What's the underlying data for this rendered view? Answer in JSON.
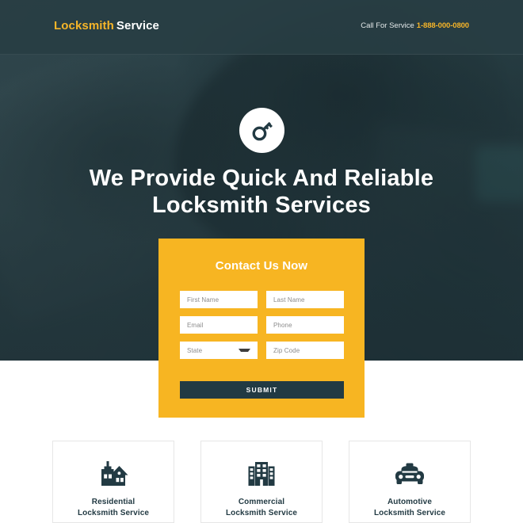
{
  "header": {
    "logo_primary": "Locksmith",
    "logo_secondary": "Service",
    "call_label": "Call For Service",
    "phone": "1-888-000-0800",
    "accent_color": "#f6b529",
    "bar_color": "#283d43"
  },
  "hero": {
    "badge_icon": "key-icon",
    "headline_line1": "We Provide Quick And Reliable",
    "headline_line2": "Locksmith Services",
    "background_image": "blurred-door-lock-photo",
    "overlay_color": "#24383e"
  },
  "form": {
    "title": "Contact Us Now",
    "background_color": "#f7b522",
    "fields": [
      {
        "name": "first-name",
        "placeholder": "First Name",
        "value": "",
        "type": "text"
      },
      {
        "name": "last-name",
        "placeholder": "Last Name",
        "value": "",
        "type": "text"
      },
      {
        "name": "email",
        "placeholder": "Email",
        "value": "",
        "type": "email"
      },
      {
        "name": "phone",
        "placeholder": "Phone",
        "value": "",
        "type": "tel"
      },
      {
        "name": "state",
        "placeholder": "State",
        "value": "",
        "type": "select"
      },
      {
        "name": "zip-code",
        "placeholder": "Zip Code",
        "value": "",
        "type": "text"
      }
    ],
    "submit_label": "SUBMIT",
    "submit_color": "#223a43"
  },
  "services": {
    "cards": [
      {
        "icon": "house-icon",
        "label_line1": "Residential",
        "label_line2": "Locksmith Service"
      },
      {
        "icon": "building-icon",
        "label_line1": "Commercial",
        "label_line2": "Locksmith Service"
      },
      {
        "icon": "car-icon",
        "label_line1": "Automotive",
        "label_line2": "Locksmith Service"
      }
    ]
  }
}
